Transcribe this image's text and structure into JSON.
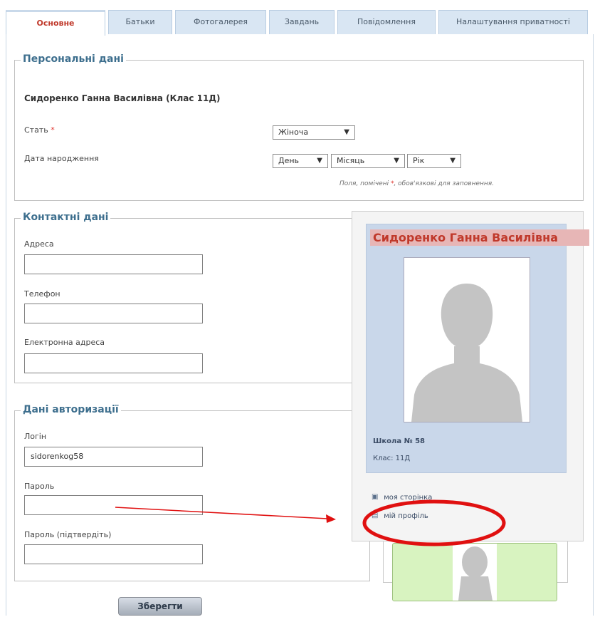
{
  "tabs": [
    {
      "label": "Основне",
      "active": true
    },
    {
      "label": "Батьки"
    },
    {
      "label": "Фотогалерея"
    },
    {
      "label": "Завдань"
    },
    {
      "label": "Повідомлення"
    },
    {
      "label": "Налаштування приватності"
    }
  ],
  "personal": {
    "legend": "Персональні дані",
    "full_name": "Сидоренко Ганна Василівна (Клас 11Д)",
    "gender_label": "Стать",
    "required_mark": "*",
    "gender_value": "Жіноча",
    "birth_label": "Дата народження",
    "day_placeholder": "День",
    "month_placeholder": "Місяць",
    "year_placeholder": "Рік",
    "required_note_before": "Поля, помічені ",
    "required_note_after": ", обов'язкові для заповнення."
  },
  "contacts": {
    "legend": "Контактні дані",
    "address_label": "Адреса",
    "address_value": "",
    "phone_label": "Телефон",
    "phone_value": "",
    "email_label": "Електронна адреса",
    "email_value": ""
  },
  "auth": {
    "legend": "Дані авторизації",
    "login_label": "Логін",
    "login_value": "sidorenkog58",
    "password_label": "Пароль",
    "password_value": "",
    "password_confirm_label": "Пароль (підтвердіть)",
    "password_confirm_value": ""
  },
  "profile_card": {
    "name": "Сидоренко Ганна Василівна",
    "school": "Школа № 58",
    "class": "Клас: 11Д",
    "links": {
      "my_page": "моя сторінка",
      "my_profile": "мій профіль"
    }
  },
  "save_button": "Зберегти",
  "colors": {
    "accent_red": "#c0392b",
    "legend_blue": "#3e6f8e",
    "annotation_red": "#e01010"
  }
}
